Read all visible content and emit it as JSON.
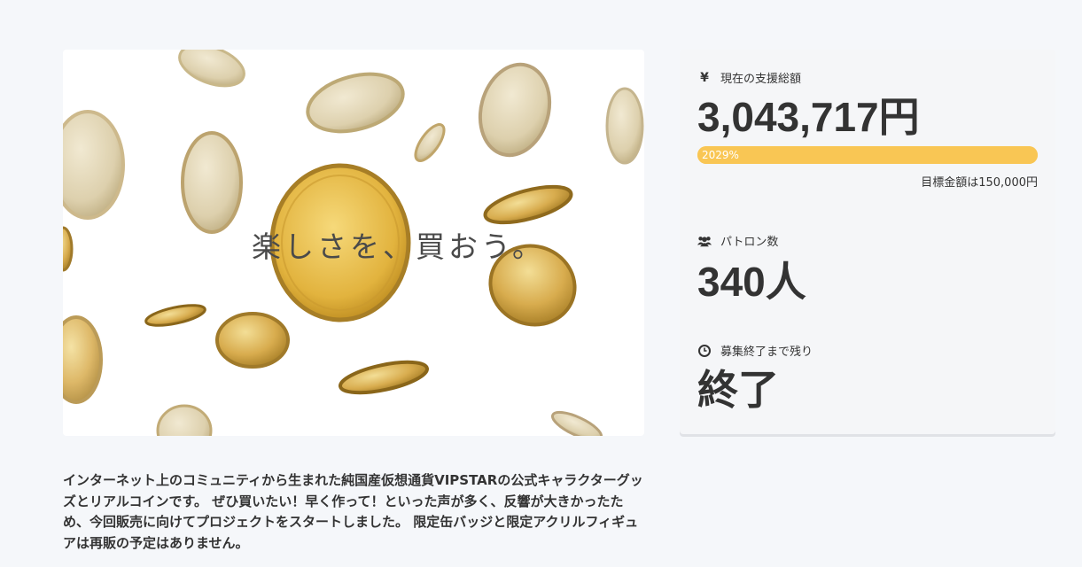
{
  "hero": {
    "caption": "楽しさを、買おう。"
  },
  "description": {
    "text": "インターネット上のコミュニティから生まれた純国産仮想通貨VIPSTARの公式キャラクターグッズとリアルコインです。 ぜひ買いたい！早く作って！といった声が多く、反響が大きかったため、今回販売に向けてプロジェクトをスタートしました。 限定缶バッジと限定アクリルフィギュアは再販の予定はありません。"
  },
  "stats": {
    "amount": {
      "icon": "yen-icon",
      "icon_glyph": "¥",
      "label": "現在の支援総額",
      "value": "3,043,717円",
      "progress_label": "2029%",
      "progress_fraction": 1.0,
      "goal": "目標金額は150,000円"
    },
    "backers": {
      "icon": "users-icon",
      "label": "パトロン数",
      "value": "340人"
    },
    "remaining": {
      "icon": "clock-icon",
      "label": "募集終了まで残り",
      "value": "終了"
    }
  },
  "colors": {
    "progress": "#f9c654",
    "coin_light": "#e8d7a8",
    "coin_mid": "#d4b063",
    "coin_dark": "#a8822c"
  }
}
